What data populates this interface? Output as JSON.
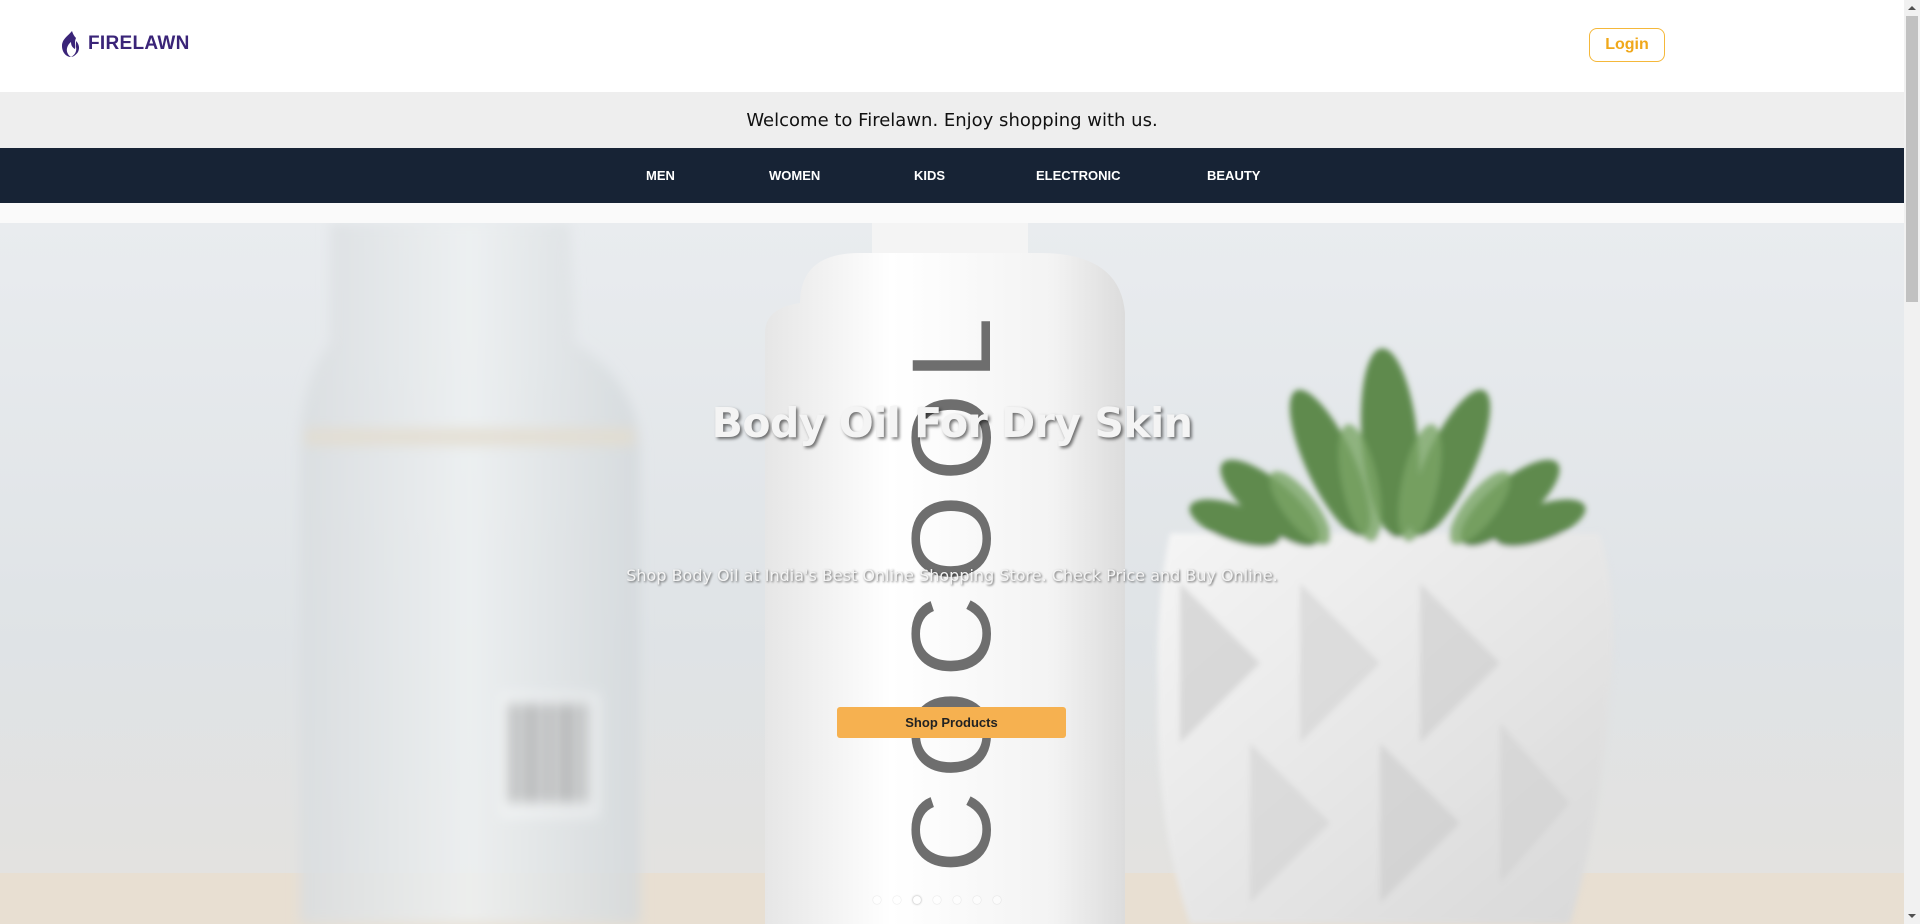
{
  "brand": {
    "name": "FIRELAWN",
    "color": "#3a2478"
  },
  "header": {
    "login_label": "Login",
    "accent": "#f5b83a"
  },
  "welcome": {
    "text": "Welcome to Firelawn. Enjoy shopping with us."
  },
  "nav": {
    "background": "#172335",
    "items": [
      {
        "label": "MEN"
      },
      {
        "label": "WOMEN"
      },
      {
        "label": "KIDS"
      },
      {
        "label": "ELECTRONIC"
      },
      {
        "label": "BEAUTY"
      }
    ]
  },
  "hero": {
    "title": "Body Oil For Dry Skin",
    "subtitle": "Shop Body Oil at India's Best Online Shopping Store. Check Price and Buy Online.",
    "cta_label": "Shop Products",
    "cta_color": "#f6b150",
    "bottle_text": "COCOOL",
    "slides_total": 7,
    "active_slide": 3
  },
  "icons": {
    "logo": "flame-icon",
    "scroll_up": "chevron-up-icon",
    "scroll_down": "chevron-down-icon"
  }
}
